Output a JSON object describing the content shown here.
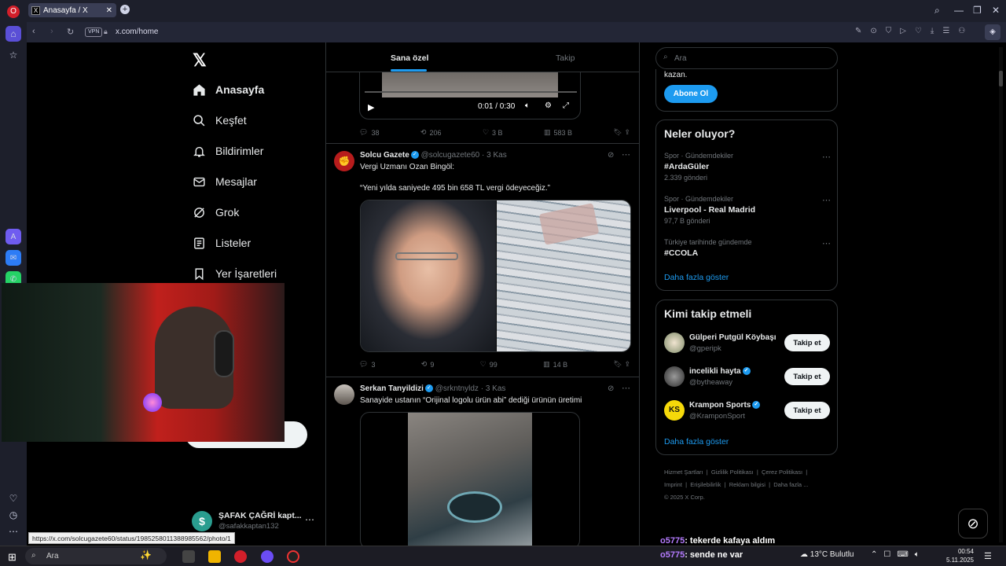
{
  "browser": {
    "tab_title": "Anasayfa / X",
    "url": "x.com/home",
    "vpn_label": "VPN",
    "status_url": "https://x.com/solcugazete60/status/1985258011388985562/photo/1"
  },
  "nav": {
    "items": [
      {
        "label": "Anasayfa",
        "icon": "home-icon"
      },
      {
        "label": "Keşfet",
        "icon": "search-icon"
      },
      {
        "label": "Bildirimler",
        "icon": "bell-icon"
      },
      {
        "label": "Mesajlar",
        "icon": "mail-icon"
      },
      {
        "label": "Grok",
        "icon": "grok-icon"
      },
      {
        "label": "Listeler",
        "icon": "list-icon"
      },
      {
        "label": "Yer İşaretleri",
        "icon": "bookmark-icon"
      }
    ],
    "profile_name": "ŞAFAK ÇAĞRİ kapt...",
    "profile_handle": "@safakkaptan132",
    "profile_initial": "$"
  },
  "feed": {
    "tabs": [
      {
        "label": "Sana özel"
      },
      {
        "label": "Takip"
      }
    ],
    "video": {
      "time": "0:01 / 0:30"
    },
    "tweet0_stats": {
      "replies": "38",
      "retweets": "206",
      "likes": "3 B",
      "views": "583 B"
    },
    "tweet1": {
      "author": "Solcu Gazete",
      "handle": "@solcugazete60",
      "date": "3 Kas",
      "line1": "Vergi Uzmanı Ozan Bingöl:",
      "line2": "“Yeni yılda saniyede 495 bin 658 TL vergi ödeyeceğiz.”",
      "replies": "3",
      "retweets": "9",
      "likes": "99",
      "views": "14 B"
    },
    "tweet2": {
      "author": "Serkan Tanyildizi",
      "handle": "@srkntnyldz",
      "date": "3 Kas",
      "text": "Sanayide ustanın “Orijinal logolu ürün abi” dediği ürünün üretimi"
    }
  },
  "right": {
    "search_placeholder": "Ara",
    "premium_tail": "kazan.",
    "subscribe_label": "Abone Ol",
    "trends_title": "Neler oluyor?",
    "trends": [
      {
        "meta": "Spor · Gündemdekiler",
        "name": "#ArdaGüler",
        "count": "2.339 gönderi"
      },
      {
        "meta": "Spor · Gündemdekiler",
        "name": "Liverpool - Real Madrid",
        "count": "97,7 B gönderi"
      },
      {
        "meta": "Türkiye tarihinde gündemde",
        "name": "#CCOLA",
        "count": ""
      }
    ],
    "show_more": "Daha fazla göster",
    "follow_title": "Kimi takip etmeli",
    "suggestions": [
      {
        "name": "Gülperi Putgül Köybaşı",
        "handle": "@gperipk",
        "verified": false
      },
      {
        "name": "incelikli hayta",
        "handle": "@bytheaway",
        "verified": true
      },
      {
        "name": "Krampon Sports",
        "handle": "@KramponSport",
        "verified": true
      }
    ],
    "follow_label": "Takip et",
    "show_more2": "Daha fazla göster",
    "footer": {
      "l1": [
        "Hizmet Şartları",
        "Gizlilik Politikası",
        "Çerez Politikası"
      ],
      "l2": [
        "Imprint",
        "Erişilebilirlik",
        "Reklam bilgisi",
        "Daha fazla ..."
      ],
      "copyright": "© 2025 X Corp."
    }
  },
  "chat": {
    "msg1_user": "o5775",
    "msg1_text": ": tekerde kafaya aldım",
    "msg2_user": "o5775",
    "msg2_text": ": sende ne var"
  },
  "taskbar": {
    "search": "Ara",
    "weather": "13°C  Bulutlu",
    "time": "00:54",
    "date": "5.11.2025"
  },
  "colors": {
    "accent": "#1d9bf0",
    "bg": "#000000",
    "border": "#2f3336"
  }
}
